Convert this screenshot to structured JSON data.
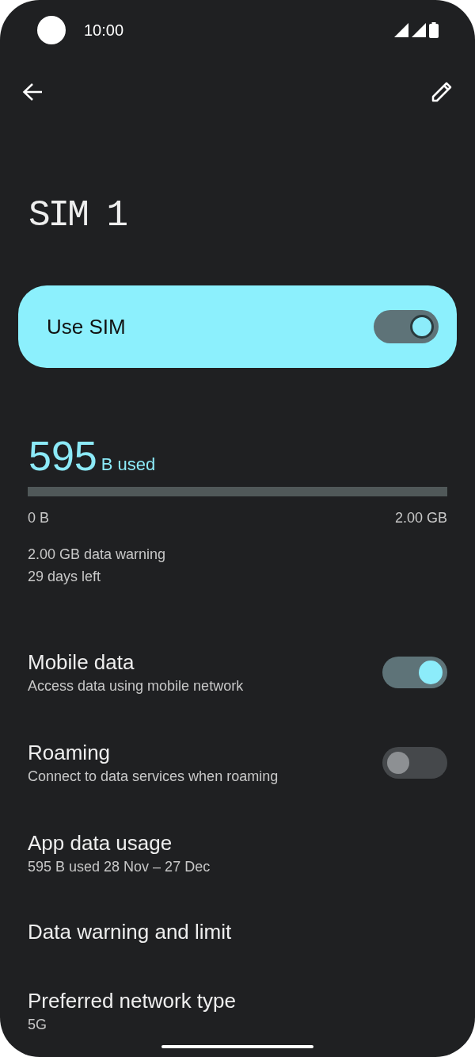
{
  "status_bar": {
    "time": "10:00"
  },
  "title": "SIM 1",
  "use_sim": {
    "label": "Use SIM",
    "on": true
  },
  "usage": {
    "amount": "595",
    "unit": "B used",
    "level": 0,
    "min_label": "0 B",
    "max_label": "2.00 GB",
    "warning": "2.00 GB data warning",
    "days_left": "29 days left"
  },
  "settings": [
    {
      "kind": "switch",
      "title": "Mobile data",
      "summary": "Access data using mobile network",
      "on": true
    },
    {
      "kind": "switch",
      "title": "Roaming",
      "summary": "Connect to data services when roaming",
      "on": false
    },
    {
      "kind": "link",
      "title": "App data usage",
      "summary": "595 B used 28 Nov – 27 Dec"
    },
    {
      "kind": "link",
      "title": "Data warning and limit"
    },
    {
      "kind": "link",
      "title": "Preferred network type",
      "summary": "5G"
    }
  ]
}
